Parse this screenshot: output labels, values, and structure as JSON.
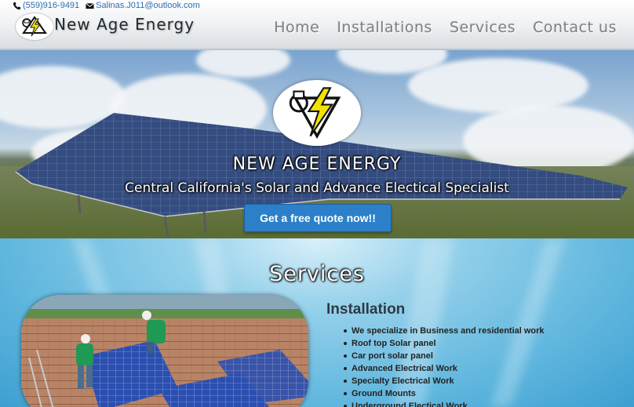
{
  "header": {
    "phone": "(559)916-9491",
    "email": "Salinas.J011@outlook.com",
    "brand": "New Age Energy",
    "nav": [
      {
        "label": "Home"
      },
      {
        "label": "Installations"
      },
      {
        "label": "Services"
      },
      {
        "label": "Contact us"
      }
    ]
  },
  "hero": {
    "title": "NEW AGE ENERGY",
    "subtitle": "Central California's Solar and Advance Electical Specialist",
    "cta_label": "Get a free quote now!!"
  },
  "services": {
    "title": "Services",
    "installation": {
      "heading": "Installation",
      "items": [
        "We specialize in Business and residential work",
        "Roof top Solar panel",
        "Car port solar panel",
        "Advanced Electrical Work",
        "Specialty Electrical Work",
        "Ground Mounts",
        "Underground Electical Work"
      ]
    }
  },
  "icons": {
    "phone": "phone-icon",
    "email": "envelope-icon",
    "logo": "plug-lightning-logo"
  },
  "colors": {
    "link": "#2a6db0",
    "button": "#2b80c9",
    "lightning": "#f4e300"
  }
}
